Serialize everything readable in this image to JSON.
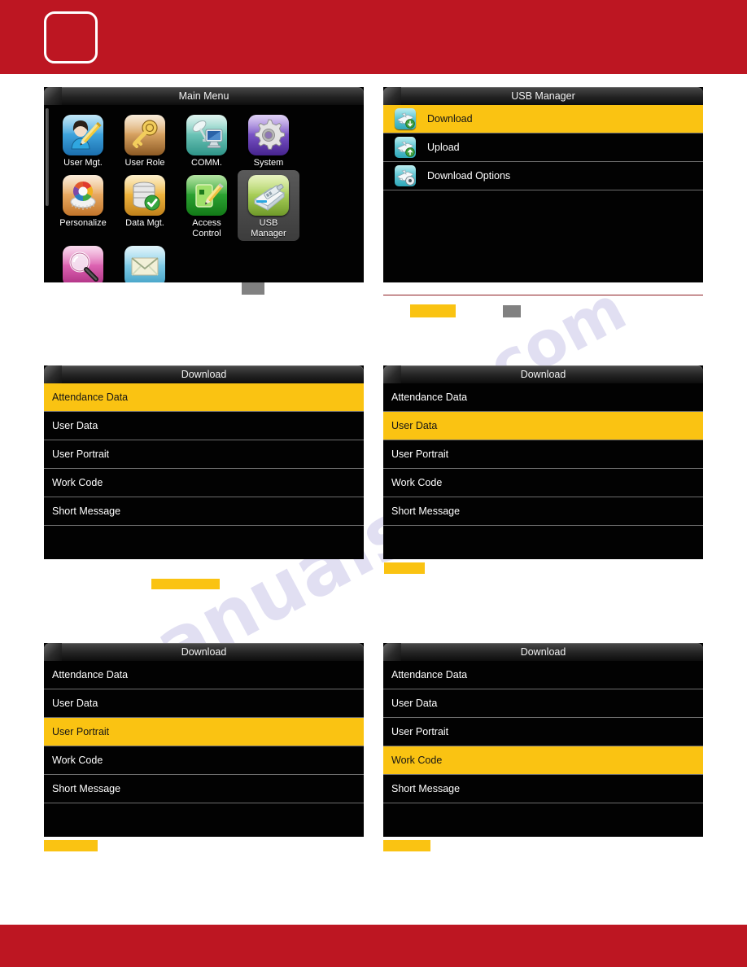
{
  "banner": {
    "top_color": "#bd1622",
    "bottom_color": "#bd1622",
    "logo_alt": "logo-placeholder"
  },
  "watermark": {
    "line1": "manualshive",
    "line2": ".com"
  },
  "main_menu": {
    "title": "Main Menu",
    "items": [
      {
        "label": "User Mgt.",
        "icon": "user-edit-icon",
        "selected": false
      },
      {
        "label": "User Role",
        "icon": "key-icon",
        "selected": false
      },
      {
        "label": "COMM.",
        "icon": "network-icon",
        "selected": false
      },
      {
        "label": "System",
        "icon": "gear-icon",
        "selected": false
      },
      {
        "label": "Personalize",
        "icon": "color-wheel-icon",
        "selected": false
      },
      {
        "label": "Data Mgt.",
        "icon": "database-check-icon",
        "selected": false
      },
      {
        "label": "Access\nControl",
        "icon": "card-edit-icon",
        "selected": false
      },
      {
        "label": "USB\nManager",
        "icon": "usb-drive-icon",
        "selected": true
      },
      {
        "label": "Attendance\nSearch",
        "icon": "magnifier-icon",
        "selected": false
      },
      {
        "label": "Short\nMessage",
        "icon": "envelope-icon",
        "selected": false
      }
    ]
  },
  "usb_manager": {
    "title": "USB Manager",
    "items": [
      {
        "label": "Download",
        "icon": "plane-download-icon",
        "selected": true
      },
      {
        "label": "Upload",
        "icon": "plane-upload-icon",
        "selected": false
      },
      {
        "label": "Download Options",
        "icon": "plane-options-icon",
        "selected": false
      }
    ]
  },
  "download_panels": [
    {
      "title": "Download",
      "items": [
        "Attendance Data",
        "User Data",
        "User Portrait",
        "Work Code",
        "Short Message"
      ],
      "selected_index": 0
    },
    {
      "title": "Download",
      "items": [
        "Attendance Data",
        "User Data",
        "User Portrait",
        "Work Code",
        "Short Message"
      ],
      "selected_index": 1
    },
    {
      "title": "Download",
      "items": [
        "Attendance Data",
        "User Data",
        "User Portrait",
        "Work Code",
        "Short Message"
      ],
      "selected_index": 2
    },
    {
      "title": "Download",
      "items": [
        "Attendance Data",
        "User Data",
        "User Portrait",
        "Work Code",
        "Short Message"
      ],
      "selected_index": 3
    }
  ],
  "colors": {
    "highlight_yellow": "#fac312",
    "redaction_gray": "#818181",
    "brand_red": "#bd1622",
    "rule_red": "#8d1c22",
    "panel_black": "#020202"
  }
}
